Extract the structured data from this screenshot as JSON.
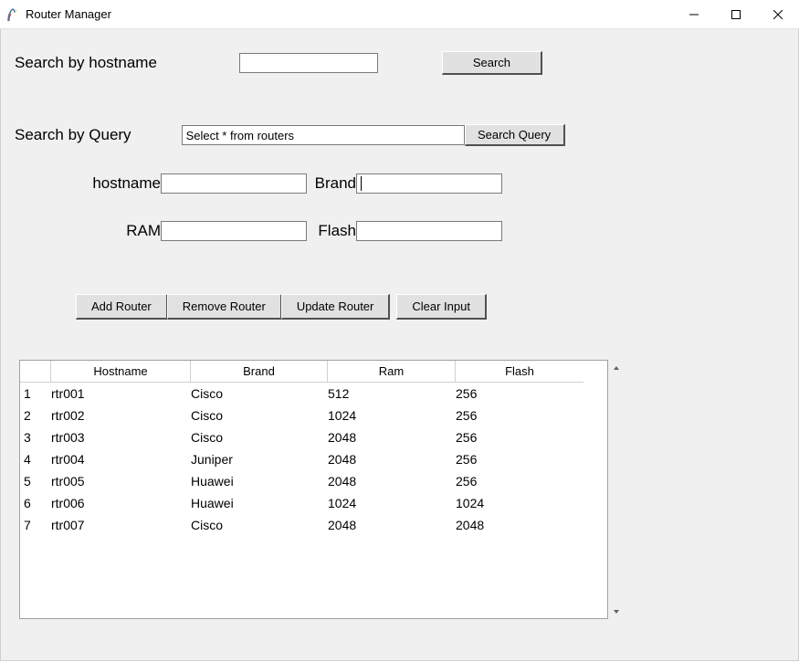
{
  "window": {
    "title": "Router Manager"
  },
  "search_hostname": {
    "label": "Search by hostname",
    "value": "",
    "button": "Search"
  },
  "search_query": {
    "label": "Search by Query",
    "value": "Select * from routers",
    "button": "Search Query"
  },
  "fields": {
    "hostname_label": "hostname",
    "hostname_value": "",
    "brand_label": "Brand",
    "brand_value": "",
    "ram_label": "RAM",
    "ram_value": "",
    "flash_label": "Flash",
    "flash_value": ""
  },
  "buttons": {
    "add": "Add Router",
    "remove": "Remove Router",
    "update": "Update Router",
    "clear": "Clear Input"
  },
  "table": {
    "headers": {
      "row": "",
      "hostname": "Hostname",
      "brand": "Brand",
      "ram": "Ram",
      "flash": "Flash"
    },
    "rows": [
      {
        "n": "1",
        "hostname": "rtr001",
        "brand": "Cisco",
        "ram": "512",
        "flash": "256"
      },
      {
        "n": "2",
        "hostname": "rtr002",
        "brand": "Cisco",
        "ram": "1024",
        "flash": "256"
      },
      {
        "n": "3",
        "hostname": "rtr003",
        "brand": "Cisco",
        "ram": "2048",
        "flash": "256"
      },
      {
        "n": "4",
        "hostname": "rtr004",
        "brand": "Juniper",
        "ram": "2048",
        "flash": "256"
      },
      {
        "n": "5",
        "hostname": "rtr005",
        "brand": "Huawei",
        "ram": "2048",
        "flash": "256"
      },
      {
        "n": "6",
        "hostname": "rtr006",
        "brand": "Huawei",
        "ram": "1024",
        "flash": "1024"
      },
      {
        "n": "7",
        "hostname": "rtr007",
        "brand": "Cisco",
        "ram": "2048",
        "flash": "2048"
      }
    ]
  }
}
